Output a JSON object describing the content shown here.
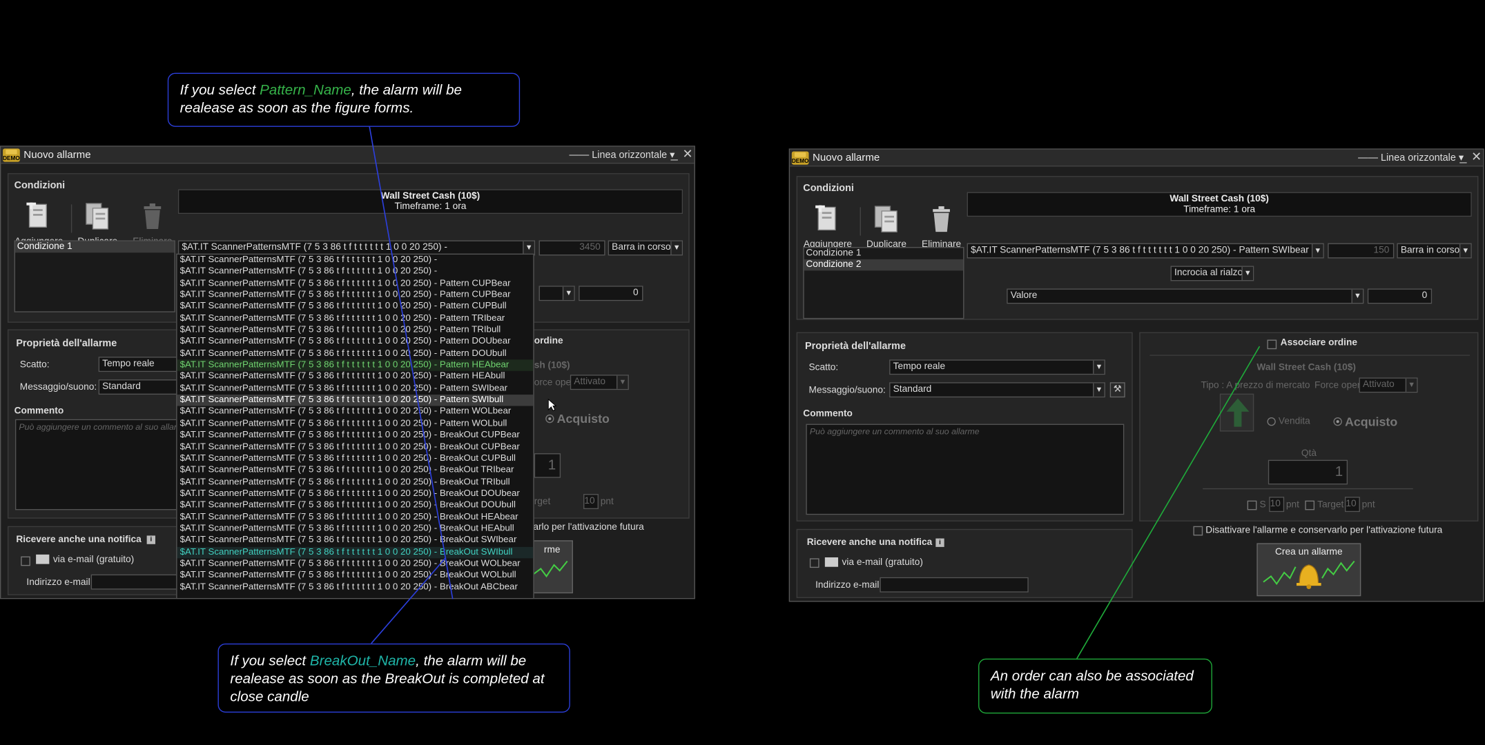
{
  "left_window": {
    "title": "Nuovo allarme",
    "line_selector": "—— Linea orizzontale",
    "conditions_label": "Condizioni",
    "toolbar": {
      "add": "Aggiungere",
      "duplicate": "Duplicare",
      "delete": "Eliminare"
    },
    "header_title": "Wall Street Cash (10$)",
    "header_sub": "Timeframe: 1 ora",
    "conditions": [
      "Condizione 1"
    ],
    "indicator_selected": "$AT.IT ScannerPatternsMTF (7 5 3 86 t f t t t t t t 1 0 0 20 250) -",
    "value_disabled": "3450",
    "bar_mode": "Barra in corso",
    "value2": "0",
    "props_label": "Proprietà dell'allarme",
    "trigger_label": "Scatto:",
    "trigger_value": "Tempo reale",
    "message_label": "Messaggio/suono:",
    "message_value": "Standard",
    "comment_label": "Commento",
    "comment_placeholder": "Può aggiungere un commento al suo allarme",
    "notify_label": "Ricevere anche una notifica",
    "email_label": "via e-mail (gratuito)",
    "email_addr_label": "Indirizzo e-mail",
    "order_label": "ordine",
    "order_title_partial": "sh (10$)",
    "force_open_partial": "orce open",
    "force_open_value": "Attivato",
    "buy_label": "Acquisto",
    "qty_value": "1",
    "target_partial": "rget",
    "target_value": "10",
    "pnt": "pnt",
    "deactivate_partial": "arlo per l'attivazione futura",
    "create_partial": "rme",
    "dropdown_items": [
      "$AT.IT ScannerPatternsMTF (7 5 3 86 t f t t t t t t 1 0 0 20 250) -",
      "$AT.IT ScannerPatternsMTF (7 5 3 86 t f t t t t t t 1 0 0 20 250) -",
      "$AT.IT ScannerPatternsMTF (7 5 3 86 t f t t t t t t 1 0 0 20 250) - Pattern CUPBear",
      "$AT.IT ScannerPatternsMTF (7 5 3 86 t f t t t t t t 1 0 0 20 250) - Pattern CUPBear",
      "$AT.IT ScannerPatternsMTF (7 5 3 86 t f t t t t t t 1 0 0 20 250) - Pattern CUPBull",
      "$AT.IT ScannerPatternsMTF (7 5 3 86 t f t t t t t t 1 0 0 20 250) - Pattern TRIbear",
      "$AT.IT ScannerPatternsMTF (7 5 3 86 t f t t t t t t 1 0 0 20 250) - Pattern TRIbull",
      "$AT.IT ScannerPatternsMTF (7 5 3 86 t f t t t t t t 1 0 0 20 250) - Pattern DOUbear",
      "$AT.IT ScannerPatternsMTF (7 5 3 86 t f t t t t t t 1 0 0 20 250) - Pattern DOUbull",
      "$AT.IT ScannerPatternsMTF (7 5 3 86 t f t t t t t t 1 0 0 20 250) - Pattern HEAbear",
      "$AT.IT ScannerPatternsMTF (7 5 3 86 t f t t t t t t 1 0 0 20 250) - Pattern HEAbull",
      "$AT.IT ScannerPatternsMTF (7 5 3 86 t f t t t t t t 1 0 0 20 250) - Pattern SWIbear",
      "$AT.IT ScannerPatternsMTF (7 5 3 86 t f t t t t t t 1 0 0 20 250) - Pattern SWIbull",
      "$AT.IT ScannerPatternsMTF (7 5 3 86 t f t t t t t t 1 0 0 20 250) - Pattern WOLbear",
      "$AT.IT ScannerPatternsMTF (7 5 3 86 t f t t t t t t 1 0 0 20 250) - Pattern WOLbull",
      "$AT.IT ScannerPatternsMTF (7 5 3 86 t f t t t t t t 1 0 0 20 250) - BreakOut CUPBear",
      "$AT.IT ScannerPatternsMTF (7 5 3 86 t f t t t t t t 1 0 0 20 250) - BreakOut CUPBear",
      "$AT.IT ScannerPatternsMTF (7 5 3 86 t f t t t t t t 1 0 0 20 250) - BreakOut CUPBull",
      "$AT.IT ScannerPatternsMTF (7 5 3 86 t f t t t t t t 1 0 0 20 250) - BreakOut TRIbear",
      "$AT.IT ScannerPatternsMTF (7 5 3 86 t f t t t t t t 1 0 0 20 250) - BreakOut TRIbull",
      "$AT.IT ScannerPatternsMTF (7 5 3 86 t f t t t t t t 1 0 0 20 250) - BreakOut DOUbear",
      "$AT.IT ScannerPatternsMTF (7 5 3 86 t f t t t t t t 1 0 0 20 250) - BreakOut DOUbull",
      "$AT.IT ScannerPatternsMTF (7 5 3 86 t f t t t t t t 1 0 0 20 250) - BreakOut HEAbear",
      "$AT.IT ScannerPatternsMTF (7 5 3 86 t f t t t t t t 1 0 0 20 250) - BreakOut HEAbull",
      "$AT.IT ScannerPatternsMTF (7 5 3 86 t f t t t t t t 1 0 0 20 250) - BreakOut SWIbear",
      "$AT.IT ScannerPatternsMTF (7 5 3 86 t f t t t t t t 1 0 0 20 250) - BreakOut SWIbull",
      "$AT.IT ScannerPatternsMTF (7 5 3 86 t f t t t t t t 1 0 0 20 250) - BreakOut WOLbear",
      "$AT.IT ScannerPatternsMTF (7 5 3 86 t f t t t t t t 1 0 0 20 250) - BreakOut WOLbull",
      "$AT.IT ScannerPatternsMTF (7 5 3 86 t f t t t t t t 1 0 0 20 250) - BreakOut ABCbear"
    ],
    "dropdown_hover_index": 12,
    "dropdown_pattern_hl_index": 9,
    "dropdown_breakout_hl_index": 25
  },
  "right_window": {
    "title": "Nuovo allarme",
    "line_selector": "—— Linea orizzontale",
    "conditions_label": "Condizioni",
    "toolbar": {
      "add": "Aggiungere",
      "duplicate": "Duplicare",
      "delete": "Eliminare"
    },
    "header_title": "Wall Street Cash (10$)",
    "header_sub": "Timeframe: 1 ora",
    "conditions": [
      "Condizione 1",
      "Condizione 2"
    ],
    "indicator_selected": "$AT.IT ScannerPatternsMTF (7 5 3 86 t f t t t t t t 1 0 0 20 250) - Pattern SWIbear",
    "value_disabled": "150",
    "bar_mode": "Barra in corso",
    "cross_mode": "Incrocia al rialzo",
    "value_type": "Valore",
    "value2": "0",
    "props_label": "Proprietà dell'allarme",
    "trigger_label": "Scatto:",
    "trigger_value": "Tempo reale",
    "message_label": "Messaggio/suono:",
    "message_value": "Standard",
    "comment_label": "Commento",
    "comment_placeholder": "Può aggiungere un commento al suo allarme",
    "notify_label": "Ricevere anche una notifica",
    "email_label": "via e-mail (gratuito)",
    "email_addr_label": "Indirizzo e-mail",
    "order_label": "Associare ordine",
    "order_title": "Wall Street Cash (10$)",
    "order_type": "Tipo : A prezzo di mercato",
    "force_open": "Force open",
    "force_open_value": "Attivato",
    "sell_label": "Vendita",
    "buy_label": "Acquisto",
    "qty_label": "Qtà",
    "qty_value": "1",
    "s_label": "S",
    "s_value": "10",
    "target_label": "Target",
    "target_value": "10",
    "pnt": "pnt",
    "deactivate_label": "Disattivare l'allarme e conservarlo per l'attivazione futura",
    "create_label": "Crea un allarme"
  },
  "callouts": {
    "pattern": {
      "pre": "If you select ",
      "highlight": "Pattern_Name",
      "post": ", the alarm will be realease as soon as the figure forms."
    },
    "breakout": {
      "pre": "If you select ",
      "highlight": "BreakOut_Name",
      "post": ", the alarm will be realease as soon as the BreakOut is completed at close candle"
    },
    "order": {
      "text": "An order can also be associated with the alarm"
    }
  },
  "colors": {
    "pattern_green": "#36b44a",
    "breakout_cyan": "#1fb5a8",
    "callout_blue": "#2c3fdc",
    "callout_green": "#1faa3a"
  }
}
